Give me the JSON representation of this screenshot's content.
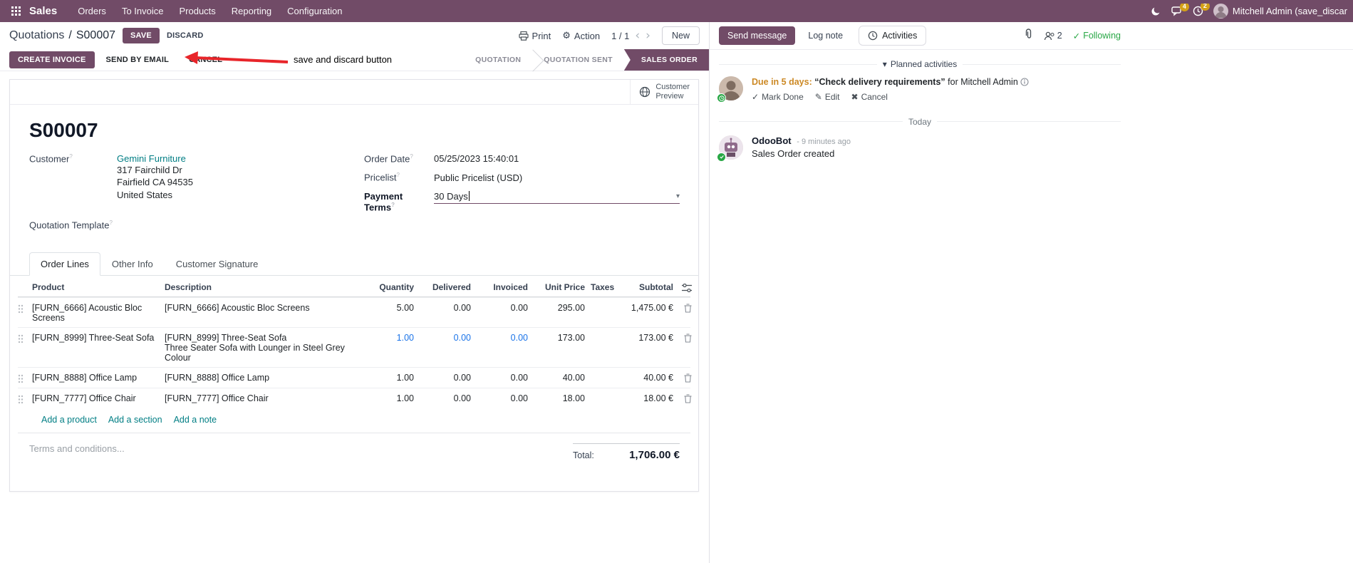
{
  "navbar": {
    "app_name": "Sales",
    "menus": [
      "Orders",
      "To Invoice",
      "Products",
      "Reporting",
      "Configuration"
    ],
    "messages_badge": "4",
    "activities_badge": "2",
    "user_name": "Mitchell Admin (save_discar"
  },
  "breadcrumb": {
    "parent": "Quotations",
    "separator": "/",
    "current": "S00007",
    "save_label": "SAVE",
    "discard_label": "DISCARD",
    "print_label": "Print",
    "action_label": "Action",
    "pager": "1 / 1",
    "new_label": "New"
  },
  "annotation": {
    "text": "save and discard button"
  },
  "statusbar": {
    "buttons": [
      "CREATE INVOICE",
      "SEND BY EMAIL",
      "CANCEL"
    ],
    "stages": [
      "QUOTATION",
      "QUOTATION SENT",
      "SALES ORDER"
    ],
    "active_stage": "SALES ORDER"
  },
  "form": {
    "customer_preview_line1": "Customer",
    "customer_preview_line2": "Preview",
    "title": "S00007",
    "help_marker": "?",
    "fields": {
      "customer_label": "Customer",
      "customer_name": "Gemini Furniture",
      "address_line1": "317 Fairchild Dr",
      "address_line2": "Fairfield CA 94535",
      "address_line3": "United States",
      "quotation_template_label": "Quotation Template",
      "order_date_label": "Order Date",
      "order_date_value": "05/25/2023 15:40:01",
      "pricelist_label": "Pricelist",
      "pricelist_value": "Public Pricelist (USD)",
      "payment_terms_label": "Payment Terms",
      "payment_terms_value": "30 Days"
    },
    "tabs": [
      "Order Lines",
      "Other Info",
      "Customer Signature"
    ],
    "table": {
      "headers": [
        "Product",
        "Description",
        "Quantity",
        "Delivered",
        "Invoiced",
        "Unit Price",
        "Taxes",
        "Subtotal"
      ],
      "rows": [
        {
          "product": "[FURN_6666] Acoustic Bloc Screens",
          "desc1": "[FURN_6666] Acoustic Bloc Screens",
          "desc2": "",
          "qty": "5.00",
          "delivered": "0.00",
          "invoiced": "0.00",
          "unit_price": "295.00",
          "taxes": "",
          "subtotal": "1,475.00 €"
        },
        {
          "product": "[FURN_8999] Three-Seat Sofa",
          "desc1": "[FURN_8999] Three-Seat Sofa",
          "desc2": "Three Seater Sofa with Lounger in Steel Grey Colour",
          "qty": "1.00",
          "delivered": "0.00",
          "invoiced": "0.00",
          "unit_price": "173.00",
          "taxes": "",
          "subtotal": "173.00 €"
        },
        {
          "product": "[FURN_8888] Office Lamp",
          "desc1": "[FURN_8888] Office Lamp",
          "desc2": "",
          "qty": "1.00",
          "delivered": "0.00",
          "invoiced": "0.00",
          "unit_price": "40.00",
          "taxes": "",
          "subtotal": "40.00 €"
        },
        {
          "product": "[FURN_7777] Office Chair",
          "desc1": "[FURN_7777] Office Chair",
          "desc2": "",
          "qty": "1.00",
          "delivered": "0.00",
          "invoiced": "0.00",
          "unit_price": "18.00",
          "taxes": "",
          "subtotal": "18.00 €"
        }
      ],
      "footer_links": [
        "Add a product",
        "Add a section",
        "Add a note"
      ]
    },
    "terms_placeholder": "Terms and conditions...",
    "total_label": "Total:",
    "total_value": "1,706.00 €"
  },
  "chatter": {
    "send_message": "Send message",
    "log_note": "Log note",
    "activities_tab": "Activities",
    "followers_count": "2",
    "following": "Following",
    "planned_header": "Planned activities",
    "activity": {
      "due": "Due in 5 days:",
      "summary": "“Check delivery requirements”",
      "for_text": "for Mitchell Admin",
      "mark_done": "Mark Done",
      "edit": "Edit",
      "cancel": "Cancel"
    },
    "today": "Today",
    "message": {
      "author": "OdooBot",
      "time": "- 9 minutes ago",
      "body": "Sales Order created"
    }
  },
  "icons": {
    "gear": "⚙",
    "check": "✓",
    "edit": "✎",
    "cancel": "✖",
    "caret_down": "▾",
    "chevron_left": "‹",
    "chevron_right": "›"
  }
}
